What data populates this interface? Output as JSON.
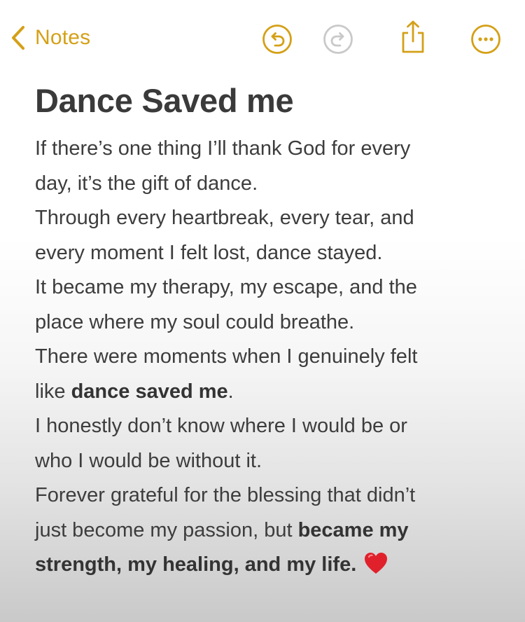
{
  "nav": {
    "back_label": "Notes",
    "accent_color": "#d4a017",
    "icons": [
      "chevron-left-icon",
      "undo-icon",
      "redo-icon",
      "share-icon",
      "more-icon"
    ]
  },
  "note": {
    "title": "Dance Saved me",
    "lines": [
      {
        "text": "If there’s one thing I’ll thank God for every"
      },
      {
        "text": "day, it’s the gift of dance."
      },
      {
        "text": "Through every heartbreak, every tear, and"
      },
      {
        "text": "every moment I felt lost, dance stayed."
      },
      {
        "text": "It became my therapy, my escape, and the"
      },
      {
        "text": "place where my soul could breathe."
      },
      {
        "text": "There were moments when I genuinely felt"
      },
      {
        "pre": "like ",
        "bold": "dance saved me",
        "post": "."
      },
      {
        "text": "I honestly don’t know where I would be or"
      },
      {
        "text": "who I would be without it."
      },
      {
        "text": "Forever grateful for the blessing that didn’t"
      },
      {
        "pre": "just become my passion, but ",
        "bold": "became my"
      },
      {
        "bold": "strength, my healing, and my life.",
        "emoji": "red-heart-icon"
      }
    ]
  }
}
